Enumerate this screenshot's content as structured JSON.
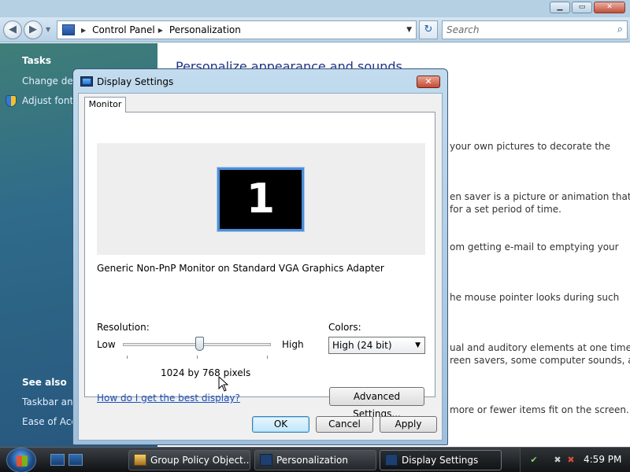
{
  "window": {
    "caption_buttons": {
      "minimize": "▁",
      "maximize": "▭",
      "close": "✕"
    },
    "nav": {
      "back": "◀",
      "forward": "▶",
      "dropdown": "▼"
    },
    "address": {
      "breadcrumbs": [
        "Control Panel",
        "Personalization"
      ],
      "separator": "▶",
      "dropdown": "▼"
    },
    "refresh_glyph": "↻",
    "search": {
      "placeholder": "Search",
      "icon": "⌕"
    }
  },
  "taskpane": {
    "tasks_heading": "Tasks",
    "items": [
      "Change desl",
      "Adjust font s"
    ],
    "see_also_heading": "See also",
    "see_also_items": [
      "Taskbar and",
      "Ease of Acce"
    ]
  },
  "content": {
    "title": "Personalize appearance and sounds",
    "lines": [
      "your own pictures to decorate the",
      "en saver is a picture or animation that",
      "for a set period of time.",
      "om getting e-mail to emptying your",
      "he mouse pointer looks during such",
      "ual and auditory elements at one time",
      "reen savers, some computer sounds, and",
      "more or fewer items fit on the screen."
    ]
  },
  "dialog": {
    "title": "Display Settings",
    "close_glyph": "✕",
    "tab": "Monitor",
    "monitor_number": "1",
    "adapter": "Generic Non-PnP Monitor on Standard VGA Graphics Adapter",
    "resolution": {
      "label": "Resolution:",
      "low": "Low",
      "high": "High",
      "value_text": "1024 by 768 pixels",
      "level": 0.52
    },
    "colors": {
      "label": "Colors:",
      "selected": "High (24 bit)",
      "arrow": "▼"
    },
    "help_link": "How do I get the best display?",
    "advanced_button": "Advanced Settings...",
    "ok": "OK",
    "cancel": "Cancel",
    "apply": "Apply"
  },
  "taskbar": {
    "buttons": [
      {
        "label": "Group Policy Object..."
      },
      {
        "label": "Personalization"
      },
      {
        "label": "Display Settings"
      }
    ],
    "tray": {
      "net": "✔",
      "netx": "✖",
      "vol": "✖"
    },
    "clock": "4:59 PM"
  },
  "colors": {
    "accent_link": "#1a4fb6",
    "title_blue": "#1e3287",
    "taskpane": "#2f6b8a"
  }
}
